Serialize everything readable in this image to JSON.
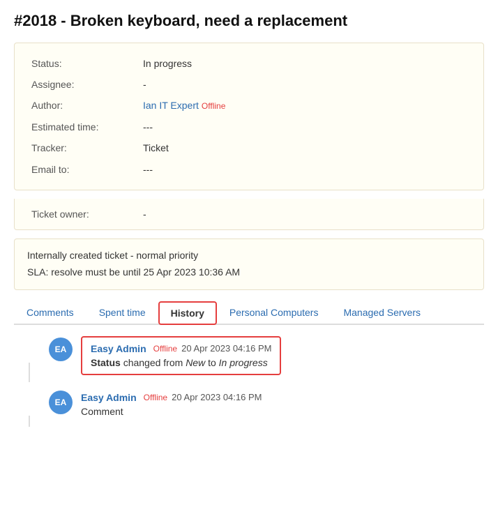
{
  "ticket": {
    "title": "#2018 - Broken keyboard, need a replacement",
    "status_label": "Status:",
    "status_value": "In progress",
    "assignee_label": "Assignee:",
    "assignee_value": "-",
    "author_label": "Author:",
    "author_name": "Ian IT Expert",
    "author_status": "Offline",
    "estimated_time_label": "Estimated time:",
    "estimated_time_value": "---",
    "tracker_label": "Tracker:",
    "tracker_value": "Ticket",
    "email_to_label": "Email to:",
    "email_to_value": "---",
    "ticket_owner_label": "Ticket owner:",
    "ticket_owner_value": "-",
    "sla_line1": "Internally created ticket - normal priority",
    "sla_line2": "SLA: resolve must be until 25 Apr 2023 10:36 AM"
  },
  "tabs": [
    {
      "id": "comments",
      "label": "Comments",
      "active": false
    },
    {
      "id": "spent-time",
      "label": "Spent time",
      "active": false
    },
    {
      "id": "history",
      "label": "History",
      "active": true
    },
    {
      "id": "personal-computers",
      "label": "Personal Computers",
      "active": false
    },
    {
      "id": "managed-servers",
      "label": "Managed Servers",
      "active": false
    }
  ],
  "history": {
    "entries": [
      {
        "id": "entry1",
        "avatar": "EA",
        "author": "Easy Admin",
        "author_status": "Offline",
        "timestamp": "20 Apr 2023 04:16 PM",
        "highlighted": true,
        "field": "Status",
        "changed_from_label": "changed from",
        "old_value": "New",
        "to_label": "to",
        "new_value": "In progress"
      },
      {
        "id": "entry2",
        "avatar": "EA",
        "author": "Easy Admin",
        "author_status": "Offline",
        "timestamp": "20 Apr 2023 04:16 PM",
        "highlighted": false,
        "comment": "Comment"
      }
    ]
  }
}
